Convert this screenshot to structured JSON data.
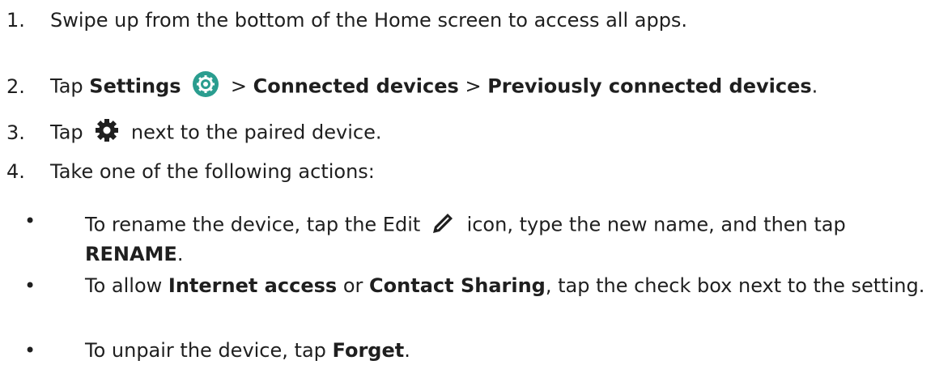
{
  "steps": [
    {
      "num": "1.",
      "text": "Swipe up from the bottom of the Home screen to access all apps."
    },
    {
      "num": "2.",
      "tap": "Tap",
      "settings": "Settings",
      "sep1": ">",
      "connected": "Connected devices",
      "sep2": ">",
      "previous": "Previously connected devices",
      "end": "."
    },
    {
      "num": "3.",
      "tap": "Tap",
      "rest": "next to the paired device."
    },
    {
      "num": "4.",
      "text": "Take one of the following actions:"
    }
  ],
  "bullets": [
    {
      "bullet": "•",
      "pre": "To rename the device, tap the Edit",
      "post": "icon, type the new name, and then tap",
      "bold": "RENAME",
      "end": "."
    },
    {
      "bullet": "•",
      "pre": "To allow",
      "bold1": "Internet access",
      "mid": "or",
      "bold2": "Contact Sharing",
      "post": ", tap the check box next to the setting."
    },
    {
      "bullet": "•",
      "pre": "To unpair the device, tap",
      "bold": "Forget",
      "end": "."
    }
  ],
  "icons": {
    "settings": "settings-app-icon",
    "gear": "gear-icon",
    "edit": "pencil-edit-icon",
    "settings_color": "#2a9d8f"
  }
}
